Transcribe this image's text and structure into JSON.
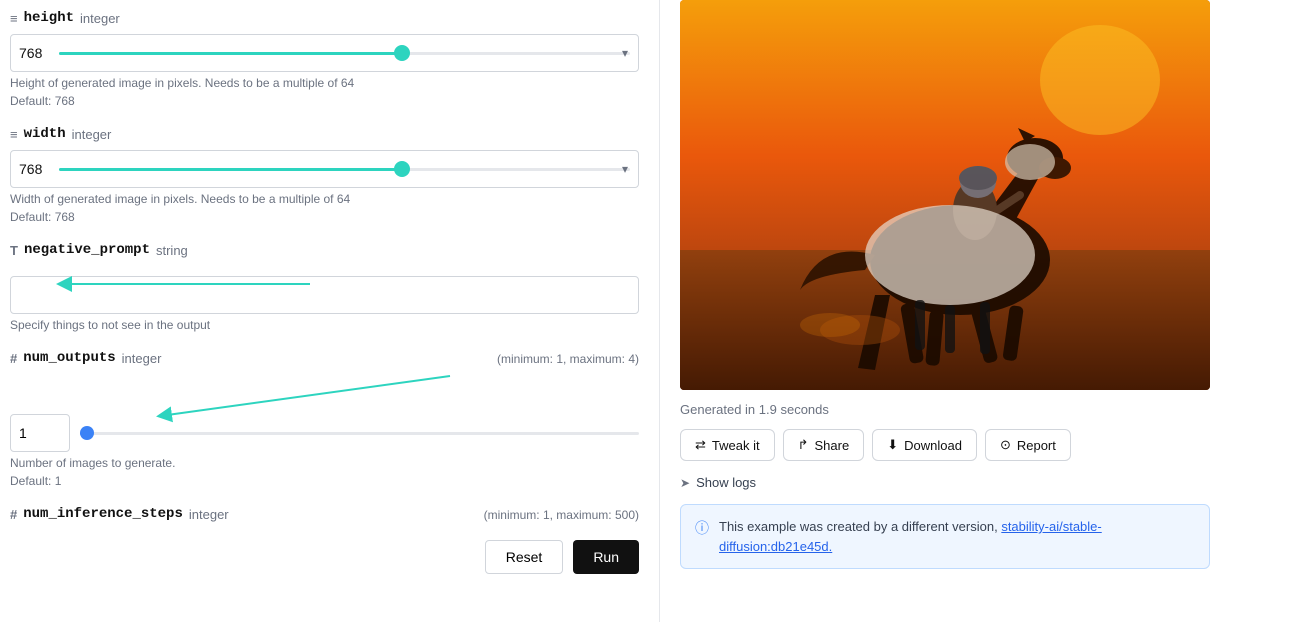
{
  "left": {
    "height": {
      "icon": "≡",
      "name": "height",
      "type": "integer",
      "value": "768",
      "sliderPercent": 60,
      "desc1": "Height of generated image in pixels. Needs to be a multiple of 64",
      "desc2": "Default: 768"
    },
    "width": {
      "icon": "≡",
      "name": "width",
      "type": "integer",
      "value": "768",
      "sliderPercent": 60,
      "desc1": "Width of generated image in pixels. Needs to be a multiple of 64",
      "desc2": "Default: 768"
    },
    "negative_prompt": {
      "icon": "T",
      "name": "negative_prompt",
      "type": "string",
      "value": "",
      "desc1": "Specify things to not see in the output"
    },
    "num_outputs": {
      "icon": "#",
      "name": "num_outputs",
      "type": "integer",
      "rangeHint": "(minimum: 1, maximum: 4)",
      "value": "1",
      "sliderPercent": 2,
      "desc1": "Number of images to generate.",
      "desc2": "Default: 1"
    },
    "num_inference_steps": {
      "icon": "#",
      "name": "num_inference_steps",
      "type": "integer",
      "rangeHint": "(minimum: 1, maximum: 500)"
    },
    "resetLabel": "Reset",
    "runLabel": "Run"
  },
  "right": {
    "generatedTime": "Generated in 1.9 seconds",
    "tweakLabel": "Tweak it",
    "shareLabel": "Share",
    "downloadLabel": "Download",
    "reportLabel": "Report",
    "showLogsLabel": "Show logs",
    "infoText": "This example was created by a different version,",
    "infoLink": "stability-ai/stable-diffusion:db21e45d.",
    "infoLinkHref": "#"
  }
}
